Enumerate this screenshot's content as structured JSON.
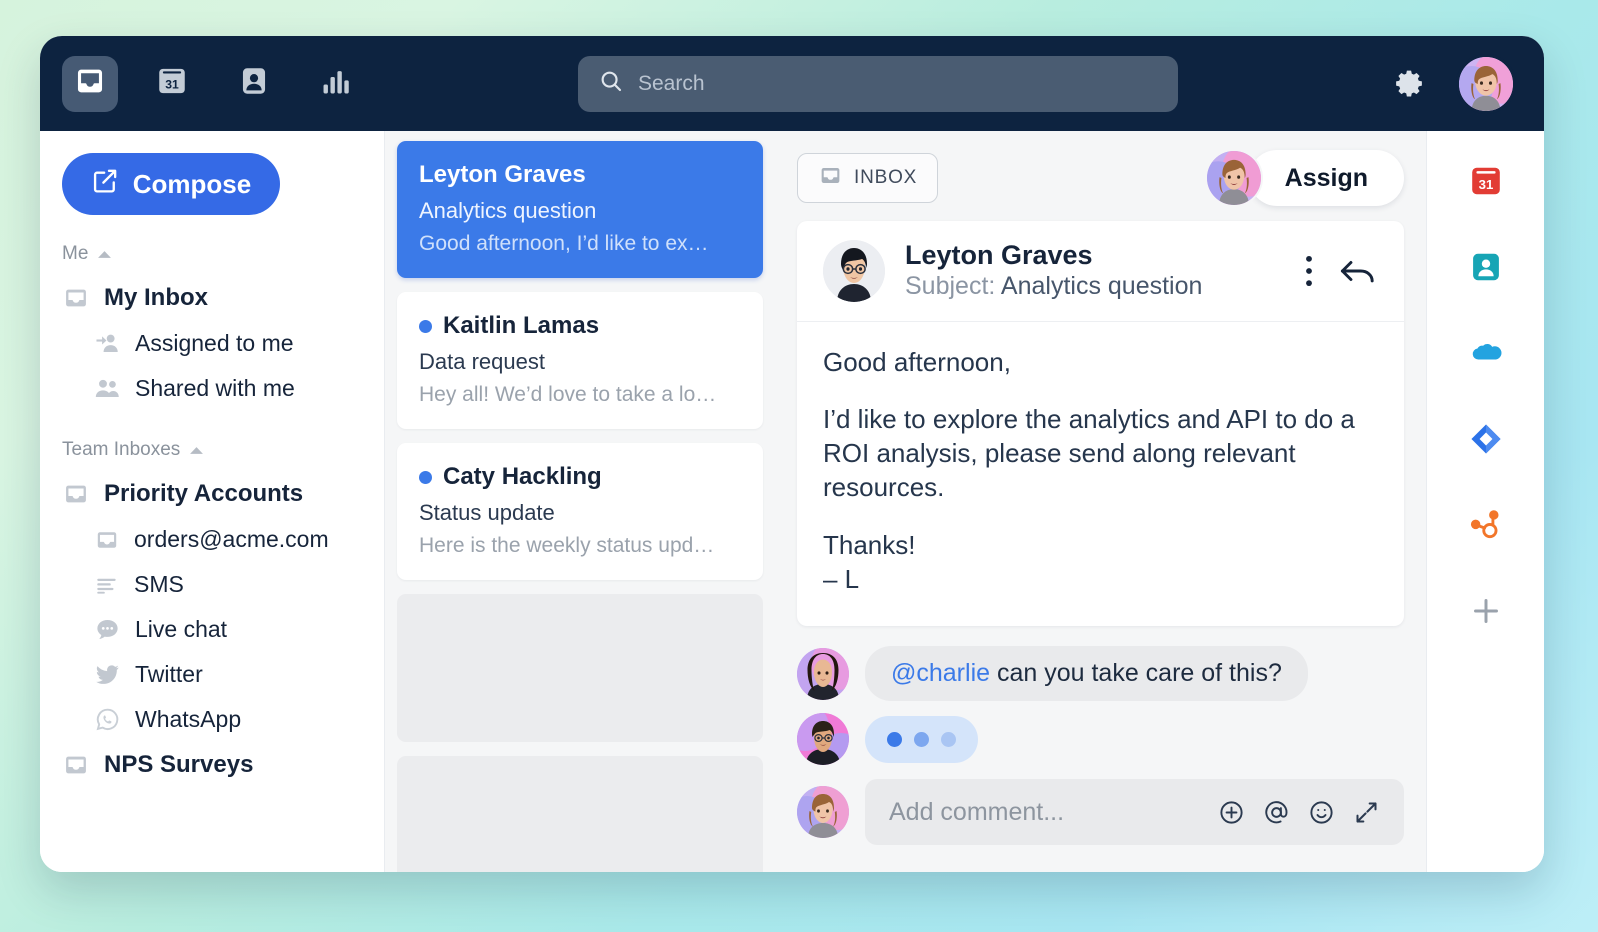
{
  "topbar": {
    "nav": [
      {
        "name": "inbox",
        "icon": "inbox-icon",
        "active": true
      },
      {
        "name": "calendar",
        "icon": "calendar-31-icon",
        "label": "31",
        "active": false
      },
      {
        "name": "contacts",
        "icon": "contact-person-icon",
        "active": false
      },
      {
        "name": "analytics",
        "icon": "bar-chart-icon",
        "active": false
      }
    ],
    "search": {
      "placeholder": "Search",
      "value": ""
    },
    "settings_icon": "gear-icon",
    "account_avatar": "user-avatar"
  },
  "sidebar": {
    "compose_label": "Compose",
    "sections": [
      {
        "label": "Me",
        "collapse_icon": "chevron-up-icon",
        "items": [
          {
            "label": "My Inbox",
            "icon": "inbox-icon",
            "level": "top"
          },
          {
            "label": "Assigned to me",
            "icon": "assigned-person-icon",
            "level": "sub"
          },
          {
            "label": "Shared with me",
            "icon": "people-icon",
            "level": "sub"
          }
        ]
      },
      {
        "label": "Team Inboxes",
        "collapse_icon": "chevron-up-icon",
        "items": [
          {
            "label": "Priority Accounts",
            "icon": "inbox-icon",
            "level": "top"
          },
          {
            "label": "orders@acme.com",
            "icon": "inbox-icon",
            "level": "sub"
          },
          {
            "label": "SMS",
            "icon": "sms-lines-icon",
            "level": "sub"
          },
          {
            "label": "Live chat",
            "icon": "chat-bubble-icon",
            "level": "sub"
          },
          {
            "label": "Twitter",
            "icon": "twitter-bird-icon",
            "level": "sub"
          },
          {
            "label": "WhatsApp",
            "icon": "whatsapp-icon",
            "level": "sub"
          },
          {
            "label": "NPS Surveys",
            "icon": "inbox-icon",
            "level": "top"
          }
        ]
      }
    ]
  },
  "conversations": [
    {
      "name": "Leyton Graves",
      "subject": "Analytics question",
      "preview": "Good afternoon, I’d like to ex…",
      "selected": true,
      "unread": false
    },
    {
      "name": "Kaitlin Lamas",
      "subject": "Data request",
      "preview": "Hey all! We’d love to take a lo…",
      "selected": false,
      "unread": true
    },
    {
      "name": "Caty Hackling",
      "subject": "Status update",
      "preview": "Here is the weekly status upd…",
      "selected": false,
      "unread": true
    }
  ],
  "conversation_placeholders": 2,
  "main": {
    "inbox_chip_label": "INBOX",
    "inbox_chip_icon": "inbox-icon",
    "assign_label": "Assign",
    "message": {
      "sender": "Leyton Graves",
      "subject_label": "Subject:",
      "subject": "Analytics question",
      "more_icon": "kebab-menu-icon",
      "reply_icon": "reply-arrow-icon",
      "paragraphs": [
        "Good afternoon,",
        "I’d like to explore the analytics and API to do a ROI analysis, please send along relevant resources."
      ],
      "signoff": [
        "Thanks!",
        "– L"
      ]
    },
    "comments": [
      {
        "mention": "@charlie",
        "text": " can you take care of this?",
        "type": "text"
      },
      {
        "type": "typing"
      }
    ],
    "comment_input": {
      "placeholder": "Add comment...",
      "value": "",
      "icons": [
        "plus-circle-icon",
        "at-mention-icon",
        "emoji-smiley-icon",
        "expand-arrows-icon"
      ]
    }
  },
  "rail": {
    "items": [
      {
        "name": "calendar-app-icon",
        "label": "31",
        "color": "#e23c34"
      },
      {
        "name": "contacts-app-icon",
        "color": "#17a5b5"
      },
      {
        "name": "salesforce-cloud-icon",
        "color": "#23a3e0"
      },
      {
        "name": "jira-diamond-icon",
        "color": "#2c72e8"
      },
      {
        "name": "hubspot-icon",
        "color": "#f2762a"
      },
      {
        "name": "add-app-icon",
        "color": "#9aa2ac"
      }
    ]
  },
  "colors": {
    "topbar_bg": "#0d2340",
    "accent_blue": "#356ae6",
    "selected_conv": "#3b7ae8",
    "panel_bg": "#f5f6f7"
  }
}
